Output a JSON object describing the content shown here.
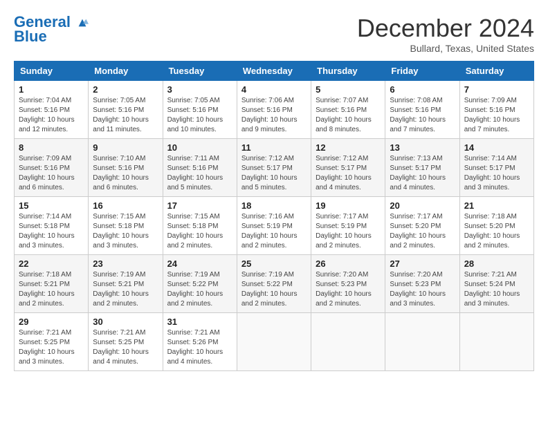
{
  "logo": {
    "line1": "General",
    "line2": "Blue"
  },
  "title": "December 2024",
  "subtitle": "Bullard, Texas, United States",
  "weekdays": [
    "Sunday",
    "Monday",
    "Tuesday",
    "Wednesday",
    "Thursday",
    "Friday",
    "Saturday"
  ],
  "weeks": [
    [
      {
        "day": "1",
        "sunrise": "7:04 AM",
        "sunset": "5:16 PM",
        "daylight": "10 hours and 12 minutes."
      },
      {
        "day": "2",
        "sunrise": "7:05 AM",
        "sunset": "5:16 PM",
        "daylight": "10 hours and 11 minutes."
      },
      {
        "day": "3",
        "sunrise": "7:05 AM",
        "sunset": "5:16 PM",
        "daylight": "10 hours and 10 minutes."
      },
      {
        "day": "4",
        "sunrise": "7:06 AM",
        "sunset": "5:16 PM",
        "daylight": "10 hours and 9 minutes."
      },
      {
        "day": "5",
        "sunrise": "7:07 AM",
        "sunset": "5:16 PM",
        "daylight": "10 hours and 8 minutes."
      },
      {
        "day": "6",
        "sunrise": "7:08 AM",
        "sunset": "5:16 PM",
        "daylight": "10 hours and 7 minutes."
      },
      {
        "day": "7",
        "sunrise": "7:09 AM",
        "sunset": "5:16 PM",
        "daylight": "10 hours and 7 minutes."
      }
    ],
    [
      {
        "day": "8",
        "sunrise": "7:09 AM",
        "sunset": "5:16 PM",
        "daylight": "10 hours and 6 minutes."
      },
      {
        "day": "9",
        "sunrise": "7:10 AM",
        "sunset": "5:16 PM",
        "daylight": "10 hours and 6 minutes."
      },
      {
        "day": "10",
        "sunrise": "7:11 AM",
        "sunset": "5:16 PM",
        "daylight": "10 hours and 5 minutes."
      },
      {
        "day": "11",
        "sunrise": "7:12 AM",
        "sunset": "5:17 PM",
        "daylight": "10 hours and 5 minutes."
      },
      {
        "day": "12",
        "sunrise": "7:12 AM",
        "sunset": "5:17 PM",
        "daylight": "10 hours and 4 minutes."
      },
      {
        "day": "13",
        "sunrise": "7:13 AM",
        "sunset": "5:17 PM",
        "daylight": "10 hours and 4 minutes."
      },
      {
        "day": "14",
        "sunrise": "7:14 AM",
        "sunset": "5:17 PM",
        "daylight": "10 hours and 3 minutes."
      }
    ],
    [
      {
        "day": "15",
        "sunrise": "7:14 AM",
        "sunset": "5:18 PM",
        "daylight": "10 hours and 3 minutes."
      },
      {
        "day": "16",
        "sunrise": "7:15 AM",
        "sunset": "5:18 PM",
        "daylight": "10 hours and 3 minutes."
      },
      {
        "day": "17",
        "sunrise": "7:15 AM",
        "sunset": "5:18 PM",
        "daylight": "10 hours and 2 minutes."
      },
      {
        "day": "18",
        "sunrise": "7:16 AM",
        "sunset": "5:19 PM",
        "daylight": "10 hours and 2 minutes."
      },
      {
        "day": "19",
        "sunrise": "7:17 AM",
        "sunset": "5:19 PM",
        "daylight": "10 hours and 2 minutes."
      },
      {
        "day": "20",
        "sunrise": "7:17 AM",
        "sunset": "5:20 PM",
        "daylight": "10 hours and 2 minutes."
      },
      {
        "day": "21",
        "sunrise": "7:18 AM",
        "sunset": "5:20 PM",
        "daylight": "10 hours and 2 minutes."
      }
    ],
    [
      {
        "day": "22",
        "sunrise": "7:18 AM",
        "sunset": "5:21 PM",
        "daylight": "10 hours and 2 minutes."
      },
      {
        "day": "23",
        "sunrise": "7:19 AM",
        "sunset": "5:21 PM",
        "daylight": "10 hours and 2 minutes."
      },
      {
        "day": "24",
        "sunrise": "7:19 AM",
        "sunset": "5:22 PM",
        "daylight": "10 hours and 2 minutes."
      },
      {
        "day": "25",
        "sunrise": "7:19 AM",
        "sunset": "5:22 PM",
        "daylight": "10 hours and 2 minutes."
      },
      {
        "day": "26",
        "sunrise": "7:20 AM",
        "sunset": "5:23 PM",
        "daylight": "10 hours and 2 minutes."
      },
      {
        "day": "27",
        "sunrise": "7:20 AM",
        "sunset": "5:23 PM",
        "daylight": "10 hours and 3 minutes."
      },
      {
        "day": "28",
        "sunrise": "7:21 AM",
        "sunset": "5:24 PM",
        "daylight": "10 hours and 3 minutes."
      }
    ],
    [
      {
        "day": "29",
        "sunrise": "7:21 AM",
        "sunset": "5:25 PM",
        "daylight": "10 hours and 3 minutes."
      },
      {
        "day": "30",
        "sunrise": "7:21 AM",
        "sunset": "5:25 PM",
        "daylight": "10 hours and 4 minutes."
      },
      {
        "day": "31",
        "sunrise": "7:21 AM",
        "sunset": "5:26 PM",
        "daylight": "10 hours and 4 minutes."
      },
      null,
      null,
      null,
      null
    ]
  ]
}
